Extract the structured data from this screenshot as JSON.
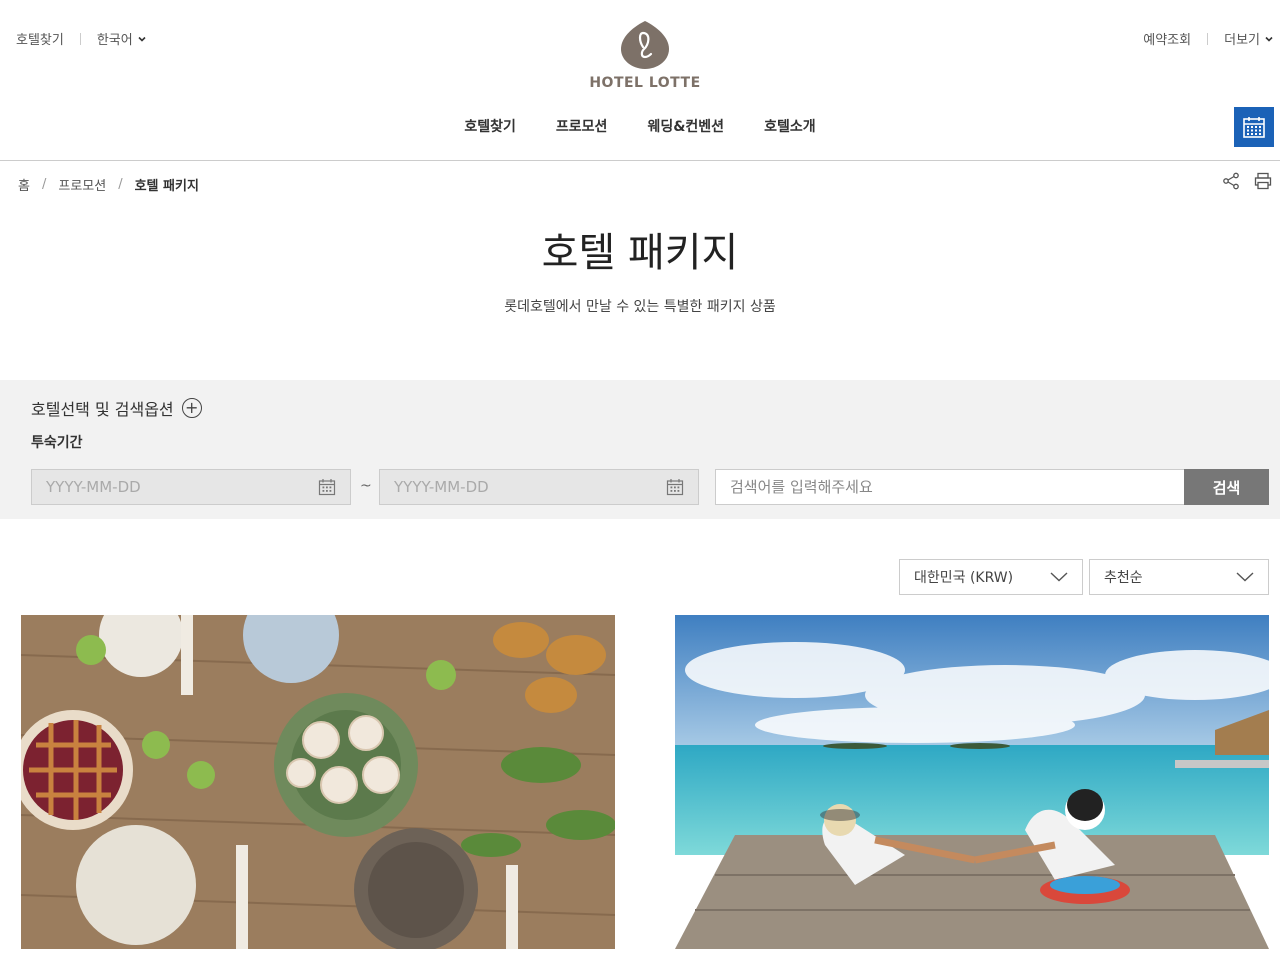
{
  "header": {
    "find_hotel": "호텔찾기",
    "language": "한국어",
    "reservation_check": "예약조회",
    "more": "더보기",
    "brand": "HOTEL LOTTE"
  },
  "gnb": [
    "호텔찾기",
    "프로모션",
    "웨딩&컨벤션",
    "호텔소개"
  ],
  "breadcrumb": [
    "홈",
    "프로모션",
    "호텔 패키지"
  ],
  "page": {
    "title": "호텔 패키지",
    "subtitle": "롯데호텔에서 만날 수 있는 특별한 패키지 상품"
  },
  "search": {
    "options_title": "호텔선택 및 검색옵션",
    "stay_label": "투숙기간",
    "date_placeholder_start": "YYYY-MM-DD",
    "tilde": "~",
    "date_placeholder_end": "YYYY-MM-DD",
    "keyword_placeholder": "검색어를 입력해주세요",
    "button": "검색"
  },
  "filters": {
    "currency": "대한민국 (KRW)",
    "sort": "추천순"
  },
  "colors": {
    "brand": "#7d7168",
    "accent_blue": "#1b62b7",
    "search_bg": "#f2f2f2",
    "search_button": "#777777"
  }
}
